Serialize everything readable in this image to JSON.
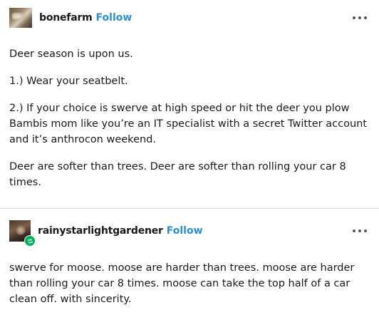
{
  "posts": [
    {
      "blog_name": "bonefarm",
      "follow_label": "Follow",
      "more_icon": "ellipsis-icon",
      "paragraphs": [
        "Deer season is upon us.",
        "1.) Wear your seatbelt.",
        "2.) If your choice is swerve at high speed or hit the deer you plow Bambis mom like you’re an IT specialist with a secret Twitter account and it’s anthrocon weekend.",
        "Deer are softer than trees. Deer are softer than rolling your car 8 times."
      ]
    },
    {
      "blog_name": "rainystarlightgardener",
      "follow_label": "Follow",
      "more_icon": "ellipsis-icon",
      "badge_icon": "reblog-icon",
      "paragraphs": [
        "swerve for moose. moose are harder than trees. moose are harder than rolling your car 8 times. moose can take the top half of a car clean off. with sincerity."
      ]
    }
  ],
  "colors": {
    "follow": "#2b8fd8",
    "reblog_badge": "#00b45a",
    "text": "#1a1a1a",
    "divider": "#dcdcdc"
  }
}
